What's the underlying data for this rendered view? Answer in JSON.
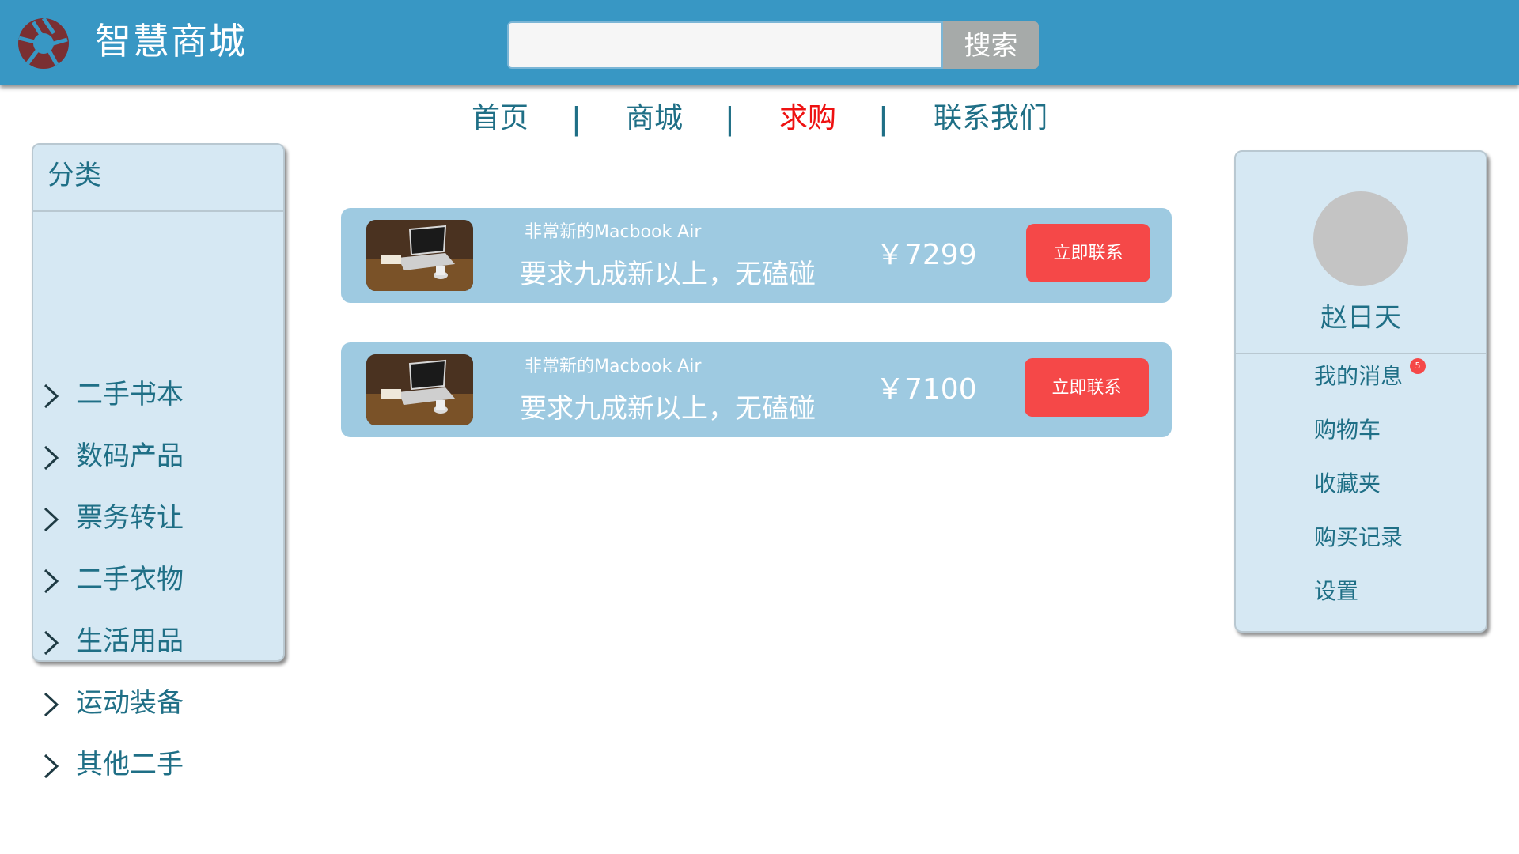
{
  "header": {
    "logo_icon": "aperture-logo-icon",
    "brand_title": "智慧商城",
    "search": {
      "placeholder": "",
      "value": "",
      "button_label": "搜索"
    },
    "colors": {
      "header_bg": "#3897c4",
      "accent_red": "#f54848",
      "text_teal": "#1f6f86",
      "panel_bg": "#d6e8f3",
      "card_bg": "#9ecae1"
    }
  },
  "nav": {
    "items": [
      {
        "label": "首页",
        "active": false
      },
      {
        "label": "商城",
        "active": false
      },
      {
        "label": "求购",
        "active": true
      },
      {
        "label": "联系我们",
        "active": false
      }
    ],
    "separator": "|"
  },
  "categories": {
    "title": "分类",
    "chevron_icon": "chevron-right-icon",
    "items": [
      {
        "label": "二手书本"
      },
      {
        "label": "数码产品"
      },
      {
        "label": "票务转让"
      },
      {
        "label": "二手衣物"
      },
      {
        "label": "生活用品"
      },
      {
        "label": "运动装备"
      },
      {
        "label": "其他二手"
      }
    ]
  },
  "requests": [
    {
      "thumb_icon": "laptop-photo-thumbnail",
      "name": "非常新的Macbook Air",
      "description": "要求九成新以上，无磕碰",
      "price": "￥7299",
      "button_label": "立即联系"
    },
    {
      "thumb_icon": "laptop-photo-thumbnail",
      "name": "非常新的Macbook Air",
      "description": "要求九成新以上，无磕碰",
      "price": "￥7100",
      "button_label": "立即联系"
    }
  ],
  "user": {
    "avatar_icon": "avatar-placeholder",
    "name": "赵日天",
    "message_badge": "5",
    "menu": [
      {
        "label": "我的消息"
      },
      {
        "label": "购物车"
      },
      {
        "label": "收藏夹"
      },
      {
        "label": "购买记录"
      },
      {
        "label": "设置"
      }
    ]
  }
}
